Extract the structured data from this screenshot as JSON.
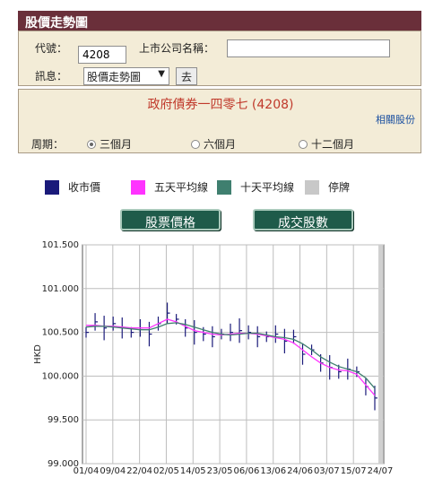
{
  "header": {
    "title": "股價走勢圖"
  },
  "form": {
    "code_label": "代號：",
    "code_value": "4208",
    "company_label": "上市公司名稱：",
    "company_value": "",
    "info_label": "訊息：",
    "info_select": "股價走勢圖",
    "go_label": "去"
  },
  "stock": {
    "title": "政府債券一四零七 (4208)",
    "related_link": "相關股份",
    "period_label": "周期：",
    "periods": [
      "三個月",
      "六個月",
      "十二個月"
    ],
    "selected_period": "三個月"
  },
  "legend": [
    {
      "label": "收市價",
      "color": "#1a1a7a"
    },
    {
      "label": "五天平均線",
      "color": "#ff33ff"
    },
    {
      "label": "十天平均線",
      "color": "#3f7f6f"
    },
    {
      "label": "停牌",
      "color": "#c8c8c8"
    }
  ],
  "buttons": {
    "price": "股票價格",
    "volume": "成交股數"
  },
  "chart_data": {
    "type": "line",
    "ylabel": "HKD",
    "ylim": [
      99.0,
      101.5
    ],
    "y_ticks": [
      "101.500",
      "101.000",
      "100.500",
      "100.000",
      "99.500",
      "99.000"
    ],
    "x_ticks": [
      "01/04",
      "09/04",
      "22/04",
      "02/05",
      "14/05",
      "23/05",
      "06/06",
      "13/06",
      "24/06",
      "03/07",
      "15/07",
      "24/07"
    ],
    "grid": true,
    "series": [
      {
        "name": "收市價",
        "color": "#1a1a7a",
        "values": [
          100.5,
          100.62,
          100.55,
          100.6,
          100.55,
          100.5,
          100.55,
          100.48,
          100.6,
          100.72,
          100.65,
          100.55,
          100.5,
          100.48,
          100.45,
          100.48,
          100.5,
          100.52,
          100.5,
          100.45,
          100.45,
          100.48,
          100.4,
          100.45,
          100.25,
          100.3,
          100.15,
          100.1,
          100.05,
          100.08,
          100.05,
          99.88,
          99.75
        ]
      },
      {
        "name": "五天平均線",
        "color": "#ff33ff",
        "values": [
          100.58,
          100.58,
          100.57,
          100.57,
          100.56,
          100.55,
          100.55,
          100.55,
          100.6,
          100.65,
          100.62,
          100.57,
          100.52,
          100.5,
          100.48,
          100.47,
          100.48,
          100.49,
          100.49,
          100.48,
          100.46,
          100.44,
          100.42,
          100.38,
          100.3,
          100.22,
          100.15,
          100.1,
          100.07,
          100.06,
          100.02,
          99.9,
          99.78
        ]
      },
      {
        "name": "十天平均線",
        "color": "#3f7f6f",
        "values": [
          100.56,
          100.57,
          100.57,
          100.56,
          100.55,
          100.54,
          100.53,
          100.53,
          100.56,
          100.6,
          100.61,
          100.59,
          100.56,
          100.53,
          100.5,
          100.48,
          100.47,
          100.48,
          100.49,
          100.49,
          100.47,
          100.45,
          100.44,
          100.42,
          100.37,
          100.3,
          100.22,
          100.16,
          100.11,
          100.08,
          100.05,
          99.98,
          99.86
        ]
      }
    ]
  }
}
